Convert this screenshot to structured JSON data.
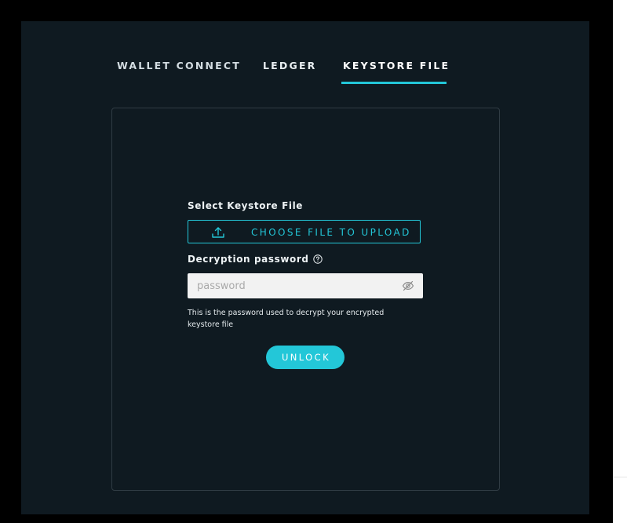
{
  "tabs": {
    "wallet_connect": "WALLET CONNECT",
    "ledger": "LEDGER",
    "keystore_file": "KEYSTORE FILE",
    "active": "keystore_file"
  },
  "form": {
    "select_label": "Select Keystore File",
    "upload_label": "CHOOSE FILE TO UPLOAD",
    "password_label": "Decryption password",
    "password_placeholder": "password",
    "password_value": "",
    "hint": "This is the password used to decrypt your encrypted keystore file",
    "unlock_label": "UNLOCK"
  },
  "icons": {
    "upload": "upload-icon",
    "help": "question-circle-icon",
    "visibility": "eye-off-icon"
  },
  "colors": {
    "background": "#000000",
    "panel": "#0f1a21",
    "accent": "#23c7d8",
    "card_border": "#303c44",
    "input_bg": "#f2f2f2"
  }
}
